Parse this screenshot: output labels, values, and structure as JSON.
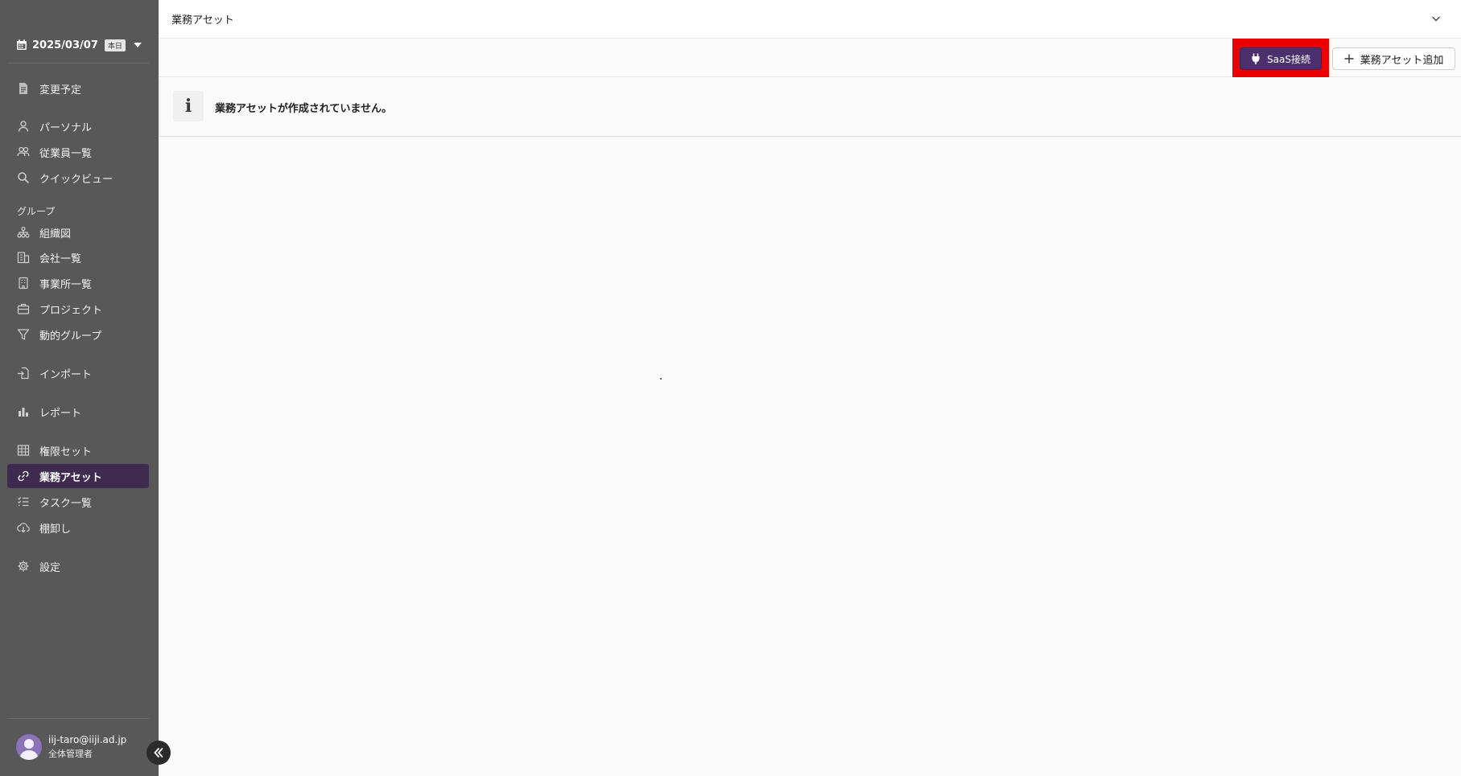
{
  "sidebar": {
    "date": "2025/03/07",
    "today_badge": "本日",
    "items_top": [
      {
        "label": "変更予定",
        "icon": "document-icon"
      }
    ],
    "items_personal": [
      {
        "label": "パーソナル",
        "icon": "person-icon"
      },
      {
        "label": "従業員一覧",
        "icon": "people-icon"
      },
      {
        "label": "クイックビュー",
        "icon": "search-icon"
      }
    ],
    "group_label": "グループ",
    "items_group": [
      {
        "label": "組織図",
        "icon": "org-chart-icon"
      },
      {
        "label": "会社一覧",
        "icon": "building-icon"
      },
      {
        "label": "事業所一覧",
        "icon": "office-icon"
      },
      {
        "label": "プロジェクト",
        "icon": "briefcase-icon"
      },
      {
        "label": "動的グループ",
        "icon": "filter-icon"
      }
    ],
    "import_label": "インポート",
    "report_label": "レポート",
    "items_assets": [
      {
        "label": "権限セット",
        "icon": "grid-icon"
      },
      {
        "label": "業務アセット",
        "icon": "link-icon"
      },
      {
        "label": "タスク一覧",
        "icon": "tasklist-icon"
      },
      {
        "label": "棚卸し",
        "icon": "cloud-download-icon"
      }
    ],
    "settings_label": "設定",
    "user": {
      "email": "iij-taro@iiji.ad.jp",
      "role": "全体管理者"
    }
  },
  "header": {
    "title": "業務アセット"
  },
  "toolbar": {
    "saas_label": "SaaS接続",
    "add_label": "業務アセット追加"
  },
  "info": {
    "icon": "i",
    "message": "業務アセットが作成されていません。"
  },
  "colors": {
    "sidebar_bg": "#585858",
    "active_bg": "#3e2b4f",
    "accent": "#4b2f6e",
    "highlight": "#ee0000"
  }
}
